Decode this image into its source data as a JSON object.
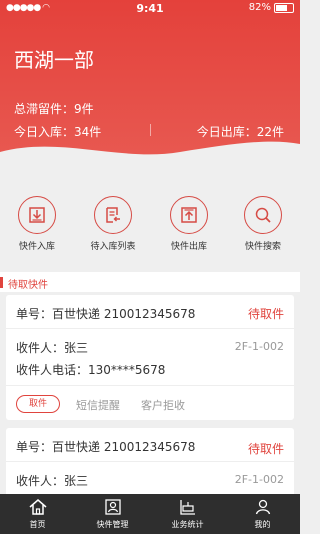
{
  "status_bar": {
    "time": "9:41",
    "battery": "82%",
    "battery_level": 0.82
  },
  "header": {
    "title": "西湖一部",
    "total_stranded": "总滞留件：9件",
    "today_in": "今日入库：34件",
    "today_out": "今日出库：22件"
  },
  "actions": [
    {
      "label": "快件入库",
      "icon": "inbox-download-icon"
    },
    {
      "label": "待入库列表",
      "icon": "list-return-icon"
    },
    {
      "label": "快件出库",
      "icon": "outbox-upload-icon"
    },
    {
      "label": "快件搜索",
      "icon": "search-icon"
    }
  ],
  "section": {
    "title": "待取快件"
  },
  "cards": [
    {
      "tracking": "单号：百世快递  210012345678",
      "status": "待取件",
      "recipient": "收件人：张三",
      "location": "2F-1-002",
      "phone": "收件人电话：130****5678",
      "take_btn": "取件",
      "sms": "短信提醒",
      "reject": "客户拒收"
    },
    {
      "tracking": "单号：百世快递  210012345678",
      "status": "待取件",
      "recipient": "收件人：张三",
      "location": "2F-1-002"
    }
  ],
  "tabs": [
    {
      "label": "首页",
      "icon": "home-icon"
    },
    {
      "label": "快件管理",
      "icon": "package-manage-icon"
    },
    {
      "label": "业务统计",
      "icon": "statistics-icon"
    },
    {
      "label": "我的",
      "icon": "user-icon"
    }
  ],
  "colors": {
    "primary": "#e4413b",
    "tabbar": "#2e2e2e"
  }
}
